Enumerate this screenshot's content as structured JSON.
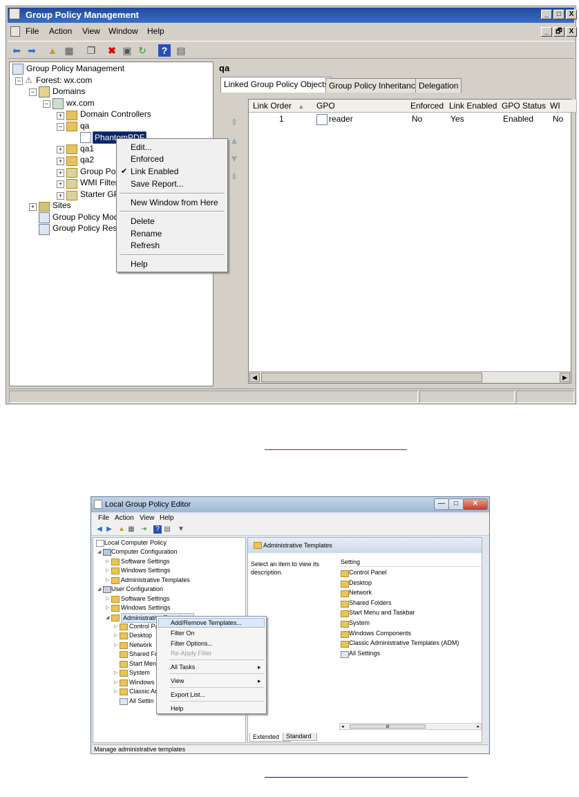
{
  "gpm": {
    "title": "Group Policy Management",
    "caption_buttons": [
      "_",
      "□",
      "X"
    ],
    "mdi_buttons": [
      "_",
      "🗗",
      "X"
    ],
    "menu": [
      "File",
      "Action",
      "View",
      "Window",
      "Help"
    ],
    "tree": {
      "root": "Group Policy Management",
      "forest": "Forest: wx.com",
      "domains": "Domains",
      "domain": "wx.com",
      "domain_controllers": "Domain Controllers",
      "qa": "qa",
      "selected": "PhantomPDF",
      "qa1": "qa1",
      "qa2": "qa2",
      "group_policy_objects": "Group Polic",
      "wmi_filters": "WMI Filters",
      "starter_gpos": "Starter GP",
      "sites": "Sites",
      "modeling": "Group Policy Mode",
      "results": "Group Policy Resul"
    },
    "breadcrumb": "qa",
    "tabs": [
      "Linked Group Policy Objects",
      "Group Policy Inheritance",
      "Delegation"
    ],
    "columns": [
      "Link Order",
      "GPO",
      "Enforced",
      "Link Enabled",
      "GPO Status",
      "WI"
    ],
    "rows": [
      {
        "link_order": "1",
        "gpo": "reader",
        "enforced": "No",
        "link_enabled": "Yes",
        "gpo_status": "Enabled",
        "wmi": "No"
      }
    ],
    "context_menu": {
      "items_a": [
        "Edit...",
        "Enforced",
        "Link Enabled",
        "Save Report..."
      ],
      "checkmark": "✔",
      "item_b": "New Window from Here",
      "items_c": [
        "Delete",
        "Rename",
        "Refresh"
      ],
      "item_d": "Help"
    }
  },
  "lgpe": {
    "title": "Local Group Policy Editor",
    "menu": [
      "File",
      "Action",
      "View",
      "Help"
    ],
    "tree": {
      "root": "Local Computer Policy",
      "computer_config": "Computer Configuration",
      "cc_children": [
        "Software Settings",
        "Windows Settings",
        "Administrative Templates"
      ],
      "user_config": "User Configuration",
      "uc_children": [
        "Software Settings",
        "Windows Settings",
        "Administrative Templates"
      ],
      "admin_children": [
        "Control Pa",
        "Desktop",
        "Network",
        "Shared Fo",
        "Start Men",
        "System",
        "Windows",
        "Classic Ac",
        "All Settin"
      ]
    },
    "right_header": "Administrative Templates",
    "description": "Select an item to view its description.",
    "setting_header": "Setting",
    "settings": [
      "Control Panel",
      "Desktop",
      "Network",
      "Shared Folders",
      "Start Menu and Taskbar",
      "System",
      "Windows Components",
      "Classic Administrative Templates (ADM)",
      "All Settings"
    ],
    "scroll_thumb": "III",
    "bottom_tabs": [
      "Extended",
      "Standard"
    ],
    "status": "Manage administrative templates",
    "context_menu": {
      "items_a": [
        "Add/Remove Templates...",
        "Filter On",
        "Filter Options...",
        "Re-Apply Filter"
      ],
      "all_tasks": "All Tasks",
      "view": "View",
      "export": "Export List...",
      "help": "Help",
      "submenu_arrow": "▸"
    }
  }
}
